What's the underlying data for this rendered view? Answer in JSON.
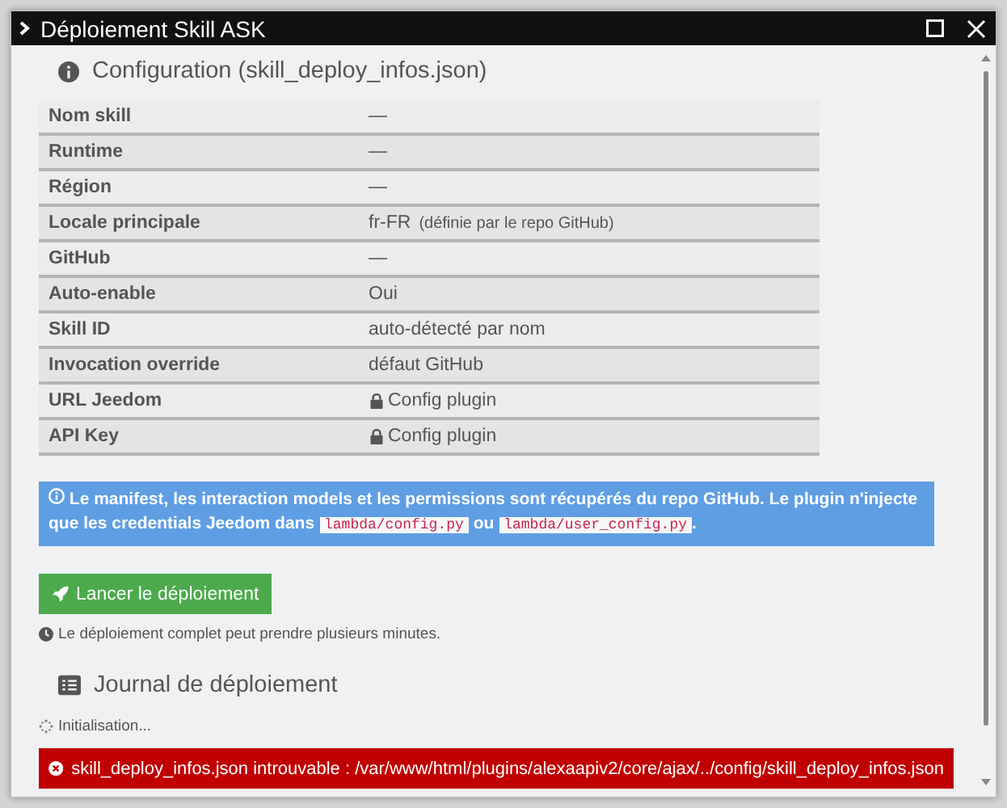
{
  "window": {
    "title": "Déploiement Skill ASK"
  },
  "config": {
    "heading": "Configuration (skill_deploy_infos.json)",
    "rows": [
      {
        "label": "Nom skill",
        "value": "—"
      },
      {
        "label": "Runtime",
        "value": "—"
      },
      {
        "label": "Région",
        "value": "—"
      },
      {
        "label": "Locale principale",
        "value": "fr-FR",
        "note": "(définie par le repo GitHub)"
      },
      {
        "label": "GitHub",
        "value": "—"
      },
      {
        "label": "Auto-enable",
        "value": "Oui"
      },
      {
        "label": "Skill ID",
        "value": "auto-détecté par nom"
      },
      {
        "label": "Invocation override",
        "value": "défaut GitHub"
      },
      {
        "label": "URL Jeedom",
        "value": "Config plugin",
        "locked": true
      },
      {
        "label": "API Key",
        "value": "Config plugin",
        "locked": true
      }
    ]
  },
  "info": {
    "parts": [
      {
        "kind": "text",
        "text": "Le manifest, les interaction models et les permissions sont récupérés du repo GitHub. Le plugin n'injecte que les credentials Jeedom dans"
      },
      {
        "kind": "code",
        "text": "lambda/config.py"
      },
      {
        "kind": "text",
        "text": "ou"
      },
      {
        "kind": "code",
        "text": "lambda/user_config.py"
      },
      {
        "kind": "text",
        "text": "."
      }
    ]
  },
  "deploy_button": "Lancer le déploiement",
  "hint": "Le déploiement complet peut prendre plusieurs minutes.",
  "journal": {
    "heading": "Journal de déploiement",
    "status": "Initialisation...",
    "error": "skill_deploy_infos.json introuvable : /var/www/html/plugins/alexaapiv2/core/ajax/../config/skill_deploy_infos.json"
  }
}
